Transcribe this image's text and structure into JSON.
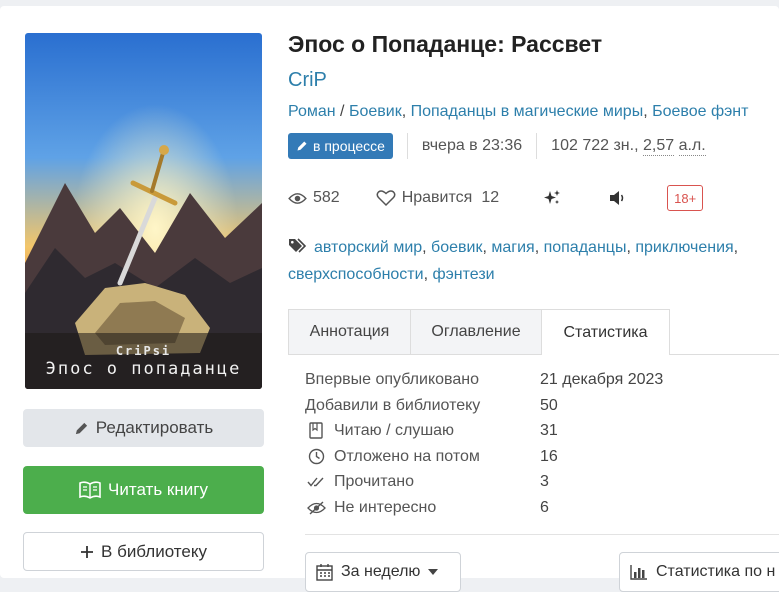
{
  "book": {
    "title": "Эпос о Попаданце: Рассвет",
    "author": "CriP",
    "genres": [
      "Роман",
      "Боевик",
      "Попаданцы в магические миры",
      "Боевое фэнт"
    ],
    "status_badge": "в процессе",
    "updated": "вчера в 23:36",
    "size_chars": "102 722 зн.,",
    "size_al_num": "2,57",
    "size_al_unit": "а.л.",
    "views": "582",
    "likes_label": "Нравится",
    "likes": "12",
    "age_rating": "18+",
    "tags": [
      "авторский мир",
      "боевик",
      "магия",
      "попаданцы",
      "приключения",
      "сверхспособности",
      "фэнтези"
    ]
  },
  "cover": {
    "author_text": "CriPsi",
    "title_text": "Эпос о попаданце"
  },
  "actions": {
    "edit": "Редактировать",
    "read": "Читать книгу",
    "library": "В библиотеку"
  },
  "tabs": [
    "Аннотация",
    "Оглавление",
    "Статистика"
  ],
  "active_tab": "Статистика",
  "statistics": [
    {
      "icon": "none",
      "label": "Впервые опубликовано",
      "value": "21 декабря 2023"
    },
    {
      "icon": "none",
      "label": "Добавили в библиотеку",
      "value": "50"
    },
    {
      "icon": "book-icon",
      "label": "Читаю / слушаю",
      "value": "31"
    },
    {
      "icon": "clock-icon",
      "label": "Отложено на потом",
      "value": "16"
    },
    {
      "icon": "double-check-icon",
      "label": "Прочитано",
      "value": "3"
    },
    {
      "icon": "eye-slash-icon",
      "label": "Не интересно",
      "value": "6"
    }
  ],
  "period_select": "За неделю",
  "stats_button": "Статистика по н",
  "colors": {
    "link": "#2d7fab",
    "badge": "#337ab7",
    "read_button": "#4cae4c",
    "age_rating": "#d9534f"
  }
}
